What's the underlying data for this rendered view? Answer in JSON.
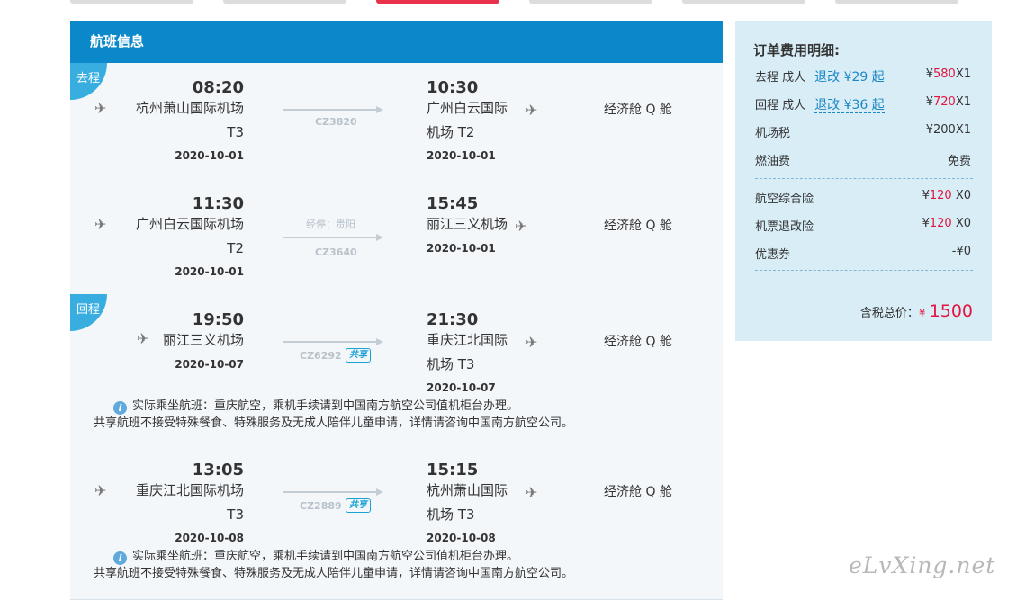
{
  "header": {
    "title": "航班信息"
  },
  "badges": {
    "outbound": "去程",
    "return": "回程"
  },
  "segments": [
    {
      "dep_time": "08:20",
      "dep_airport": "杭州萧山国际机场",
      "dep_terminal": "T3",
      "dep_date": "2020-10-01",
      "arr_time": "10:30",
      "arr_airport_l1": "广州白云国际",
      "arr_airport_l2": "机场 T2",
      "arr_date": "2020-10-01",
      "flight_no": "CZ3820",
      "cabin": "经济舱 Q 舱"
    },
    {
      "dep_time": "11:30",
      "dep_airport": "广州白云国际机场",
      "dep_terminal": "T2",
      "dep_date": "2020-10-01",
      "arr_time": "15:45",
      "arr_airport_l1": "丽江三义机场",
      "arr_date": "2020-10-01",
      "stop": "经停：贵阳",
      "flight_no": "CZ3640",
      "cabin": "经济舱 Q 舱"
    },
    {
      "dep_time": "19:50",
      "dep_airport": "丽江三义机场",
      "dep_date": "2020-10-07",
      "arr_time": "21:30",
      "arr_airport_l1": "重庆江北国际",
      "arr_airport_l2": "机场 T3",
      "arr_date": "2020-10-07",
      "flight_no": "CZ6292",
      "share": "共享",
      "cabin": "经济舱 Q 舱",
      "note1": "实际乘坐航班：重庆航空，乘机手续请到中国南方航空公司值机柜台办理。",
      "note2": "共享航班不接受特殊餐食、特殊服务及无成人陪伴儿童申请，详情请咨询中国南方航空公司。"
    },
    {
      "dep_time": "13:05",
      "dep_airport": "重庆江北国际机场",
      "dep_terminal": "T3",
      "dep_date": "2020-10-08",
      "arr_time": "15:15",
      "arr_airport_l1": "杭州萧山国际",
      "arr_airport_l2": "机场 T3",
      "arr_date": "2020-10-08",
      "flight_no": "CZ2889",
      "share": "共享",
      "cabin": "经济舱 Q 舱",
      "note1": "实际乘坐航班：重庆航空，乘机手续请到中国南方航空公司值机柜台办理。",
      "note2": "共享航班不接受特殊餐食、特殊服务及无成人陪伴儿童申请，详情请咨询中国南方航空公司。"
    }
  ],
  "info_icon": "i",
  "price": {
    "title": "订单费用明细:",
    "outbound_label": "去程 成人",
    "outbound_link": "退改 ¥29 起",
    "outbound_yen": "¥",
    "outbound_amt": "580",
    "outbound_qty": "X1",
    "return_label": "回程 成人",
    "return_link": "退改 ¥36 起",
    "return_yen": "¥",
    "return_amt": "720",
    "return_qty": "X1",
    "tax_label": "机场税",
    "tax_val": "¥200X1",
    "fuel_label": "燃油费",
    "fuel_val": "免费",
    "ins1_label": "航空综合险",
    "ins1_yen": "¥",
    "ins1_amt": "120",
    "ins1_qty": " X0",
    "ins2_label": "机票退改险",
    "ins2_yen": "¥",
    "ins2_amt": "120",
    "ins2_qty": " X0",
    "coupon_label": "优惠券",
    "coupon_val": "-¥0",
    "total_label": "含税总价：",
    "total_yen": "¥",
    "total_amt": "1500"
  },
  "watermark": "eLvXing.net",
  "colors": {
    "header_blue": "#0a88c9",
    "badge_blue": "#38aee0",
    "price_red": "#e3163f",
    "tab_active": "#e8324b",
    "price_bg": "#d9edf7"
  }
}
